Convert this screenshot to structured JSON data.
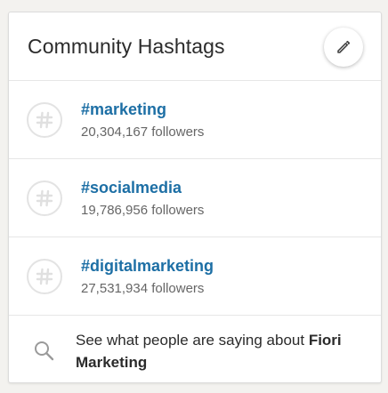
{
  "card": {
    "title": "Community Hashtags",
    "edit_icon": "pencil-icon"
  },
  "hashtags": [
    {
      "tag": "#marketing",
      "followers": "20,304,167 followers",
      "icon": "hashtag-icon"
    },
    {
      "tag": "#socialmedia",
      "followers": "19,786,956 followers",
      "icon": "hashtag-icon"
    },
    {
      "tag": "#digitalmarketing",
      "followers": "27,531,934 followers",
      "icon": "hashtag-icon"
    }
  ],
  "footer": {
    "icon": "search-icon",
    "text": "See what people are saying about ",
    "company": "Fiori Marketing"
  },
  "colors": {
    "link": "#1d6fa5",
    "text": "#2b2b2b",
    "muted": "#666666",
    "border": "#e6e6e6"
  }
}
